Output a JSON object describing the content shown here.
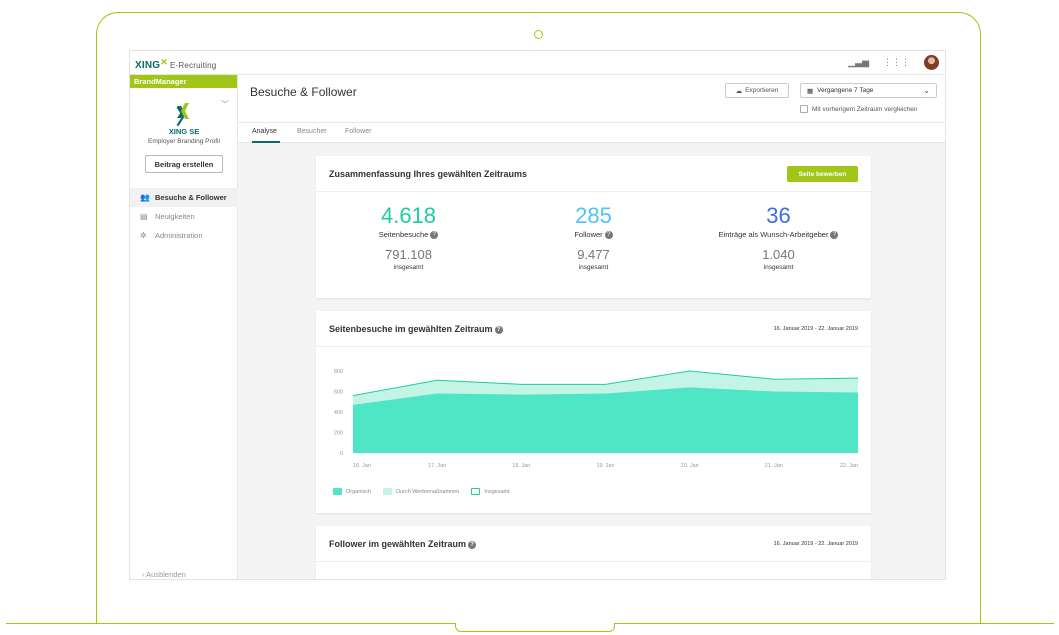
{
  "topbar": {
    "brand": "XING",
    "brand_mark": "✕",
    "product": "E-Recruiting",
    "icons": [
      "bar-chart-icon",
      "apps-grid-icon",
      "user-avatar"
    ]
  },
  "sidebar": {
    "section_label": "BrandManager",
    "company": "XING SE",
    "profile_type": "Employer Branding Profil",
    "create_button": "Beitrag erstellen",
    "items": [
      {
        "label": "Besuche & Follower",
        "icon": "people-icon",
        "active": true
      },
      {
        "label": "Neuigkeiten",
        "icon": "news-icon",
        "active": false
      },
      {
        "label": "Administration",
        "icon": "gear-icon",
        "active": false
      }
    ],
    "collapse_label": "Ausblenden"
  },
  "header": {
    "title": "Besuche & Follower",
    "export_label": "Exportieren",
    "period_select": "Vergangene 7 Tage",
    "compare_label": "Mit vorherigem Zeitraum vergleichen"
  },
  "tabs": [
    {
      "label": "Analyse",
      "active": true
    },
    {
      "label": "Besucher",
      "active": false
    },
    {
      "label": "Follower",
      "active": false
    }
  ],
  "summary": {
    "title": "Zusammenfassung Ihres gewählten Zeitraums",
    "promote_button": "Seite bewerben",
    "metrics": [
      {
        "value": "4.618",
        "label": "Seitenbesuche",
        "total": "791.108",
        "total_label": "insgesamt",
        "color": "#1dcda0"
      },
      {
        "value": "285",
        "label": "Follower",
        "total": "9.477",
        "total_label": "insgesamt",
        "color": "#4fc3f7"
      },
      {
        "value": "36",
        "label": "Einträge als Wunsch-Arbeitgeber",
        "total": "1.040",
        "total_label": "insgesamt",
        "color": "#3d6ee0"
      }
    ]
  },
  "visits_chart": {
    "title": "Seitenbesuche im gewählten Zeitraum",
    "date_range": "16. Januar 2019 - 22. Januar 2019"
  },
  "followers_chart": {
    "title": "Follower im gewählten Zeitraum",
    "date_range": "16. Januar 2019 - 22. Januar 2019"
  },
  "chart_data": {
    "type": "area",
    "x": [
      "16. Jan",
      "17. Jan",
      "18. Jan",
      "19. Jan",
      "20. Jan",
      "21. Jan",
      "22. Jan"
    ],
    "y_ticks": [
      "0",
      "200",
      "400",
      "600",
      "800"
    ],
    "ylim": [
      0,
      800
    ],
    "series": [
      {
        "name": "Organisch",
        "values": [
          470,
          580,
          570,
          580,
          640,
          600,
          590
        ],
        "color": "#4ee6c4"
      },
      {
        "name": "Durch Werbemaßnahmen",
        "values": [
          90,
          130,
          100,
          90,
          160,
          120,
          140
        ],
        "color": "#c4f4e6"
      },
      {
        "name": "Insgesamt",
        "values": [
          560,
          710,
          670,
          670,
          800,
          720,
          730
        ],
        "color": "#1dcda0"
      }
    ],
    "grid": false,
    "legend": "bottom-left"
  }
}
